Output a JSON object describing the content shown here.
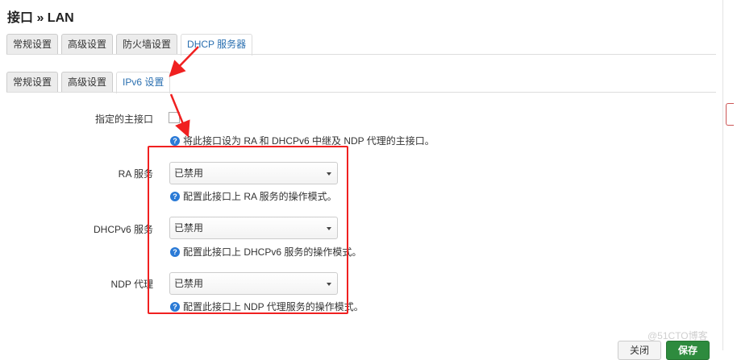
{
  "page": {
    "title": "接口 » LAN"
  },
  "main_tabs": [
    {
      "label": "常规设置",
      "active": false
    },
    {
      "label": "高级设置",
      "active": false
    },
    {
      "label": "防火墙设置",
      "active": false
    },
    {
      "label": "DHCP 服务器",
      "active": true
    }
  ],
  "sub_tabs": [
    {
      "label": "常规设置",
      "active": false
    },
    {
      "label": "高级设置",
      "active": false
    },
    {
      "label": "IPv6 设置",
      "active": true
    }
  ],
  "fields": {
    "master": {
      "label": "指定的主接口",
      "checked": false,
      "help": "将此接口设为 RA 和 DHCPv6 中继及 NDP 代理的主接口。"
    },
    "ra": {
      "label": "RA 服务",
      "value": "已禁用",
      "help": "配置此接口上 RA 服务的操作模式。"
    },
    "dhcpv6": {
      "label": "DHCPv6 服务",
      "value": "已禁用",
      "help": "配置此接口上 DHCPv6 服务的操作模式。"
    },
    "ndp": {
      "label": "NDP 代理",
      "value": "已禁用",
      "help": "配置此接口上 NDP 代理服务的操作模式。"
    }
  },
  "buttons": {
    "close": "关闭",
    "save": "保存"
  },
  "watermark": "@51CTO博客",
  "colors": {
    "accent": "#2a6fb0",
    "annotation": "#f02020",
    "save": "#2e8b3e"
  }
}
